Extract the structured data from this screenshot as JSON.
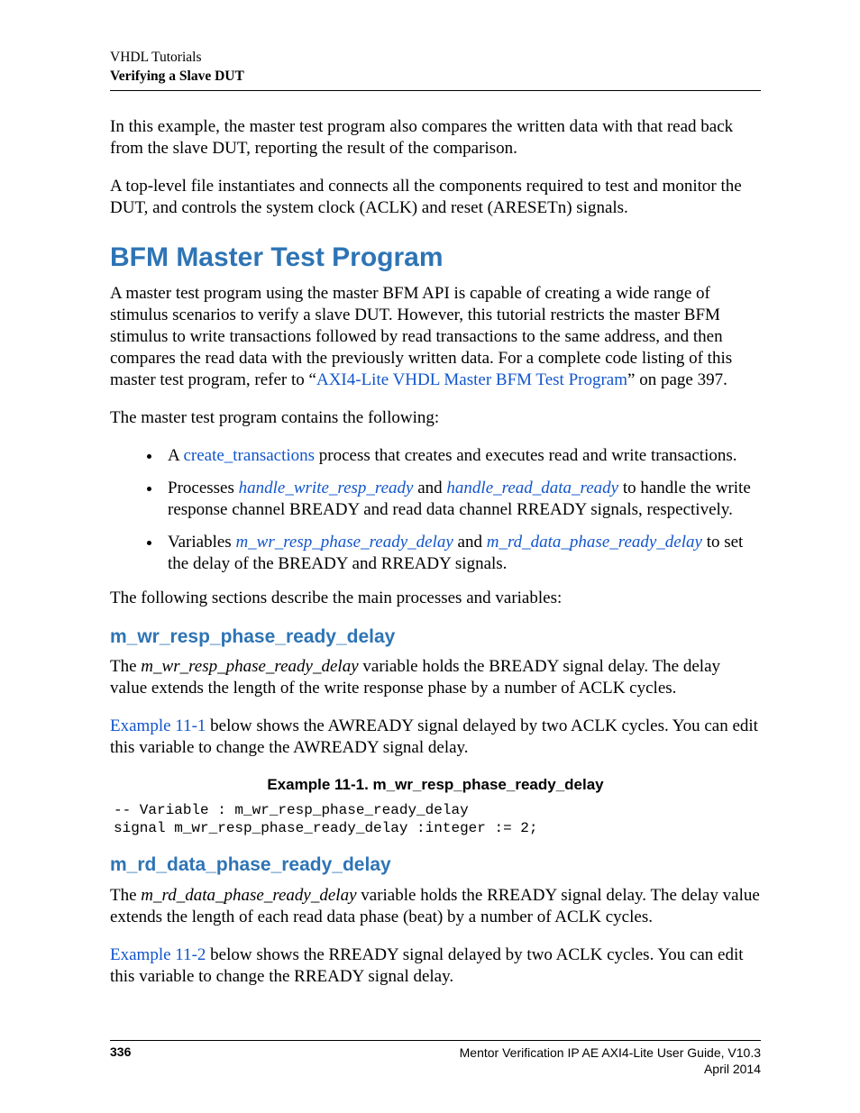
{
  "header": {
    "line1": "VHDL Tutorials",
    "line2": "Verifying a Slave DUT"
  },
  "paras": {
    "p1": "In this example, the master test program also compares the written data with that read back from the slave DUT, reporting the result of the comparison.",
    "p2": "A top-level file instantiates and connects all the components required to test and monitor the DUT, and controls the system clock (ACLK) and reset (ARESETn) signals."
  },
  "section1": {
    "title": "BFM Master Test Program",
    "intro_pre": "A master test program using the master BFM API is capable of creating a wide range of stimulus scenarios to verify a slave DUT. However, this tutorial restricts the master BFM stimulus to write transactions followed by read transactions to the same address, and then compares the read data with the previously written data. For a complete code listing of this master test program, refer to “",
    "intro_link": "AXI4-Lite VHDL Master BFM Test Program",
    "intro_post": "” on page 397.",
    "contains": "The master test program contains the following:",
    "bullets": {
      "b1_pre": "A ",
      "b1_link": "create_transactions",
      "b1_post": " process that creates and executes read and write transactions.",
      "b2_pre": "Processes ",
      "b2_link1": "handle_write_resp_ready",
      "b2_mid": " and ",
      "b2_link2": "handle_read_data_ready",
      "b2_post": " to handle the write response channel BREADY and read data channel RREADY signals, respectively.",
      "b3_pre": "Variables ",
      "b3_link1": "m_wr_resp_phase_ready_delay",
      "b3_mid": " and ",
      "b3_link2": "m_rd_data_phase_ready_delay",
      "b3_post": " to set the delay of the BREADY and RREADY signals."
    },
    "describe": "The following sections describe the main processes and variables:"
  },
  "sub1": {
    "title": "m_wr_resp_phase_ready_delay",
    "p1_pre": "The ",
    "p1_var": "m_wr_resp_phase_ready_delay",
    "p1_post": " variable holds the BREADY signal delay. The delay value extends the length of the write response phase by a number of ACLK cycles.",
    "p2_link": "Example 11-1",
    "p2_post": " below shows the AWREADY signal delayed by two ACLK cycles. You can edit this variable to change the AWREADY signal delay.",
    "example_title": "Example 11-1. m_wr_resp_phase_ready_delay",
    "code": "-- Variable : m_wr_resp_phase_ready_delay\nsignal m_wr_resp_phase_ready_delay :integer := 2;"
  },
  "sub2": {
    "title": "m_rd_data_phase_ready_delay",
    "p1_pre": "The ",
    "p1_var": "m_rd_data_phase_ready_delay",
    "p1_post": " variable holds the RREADY signal delay. The delay value extends the length of each read data phase (beat) by a number of ACLK cycles.",
    "p2_link": "Example 11-2",
    "p2_post": " below shows the RREADY signal delayed by two ACLK cycles. You can edit this variable to change the RREADY signal delay."
  },
  "footer": {
    "page": "336",
    "right1": "Mentor Verification IP AE AXI4-Lite User Guide, V10.3",
    "right2": "April 2014"
  }
}
